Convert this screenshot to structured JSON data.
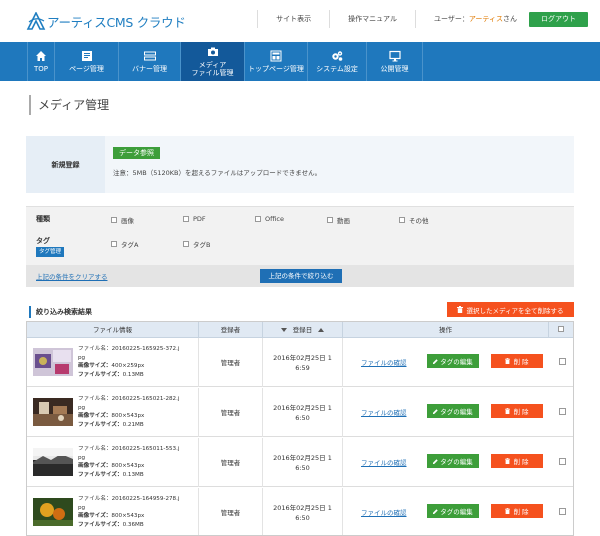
{
  "header": {
    "logo_text": "アーティスCMS クラウド",
    "site_view": "サイト表示",
    "manual": "操作マニュアル",
    "user_prefix": "ユーザー：",
    "user_name": "アーティス",
    "user_suffix": "さん",
    "logout": "ログアウト"
  },
  "nav": {
    "items": [
      {
        "label1": "TOP",
        "label2": "",
        "icon": "home-icon"
      },
      {
        "label1": "ページ管理",
        "label2": "",
        "icon": "document-icon"
      },
      {
        "label1": "バナー管理",
        "label2": "",
        "icon": "banner-icon"
      },
      {
        "label1": "メディア",
        "label2": "ファイル管理",
        "icon": "camera-icon",
        "active": true
      },
      {
        "label1": "トップページ管理",
        "label2": "",
        "icon": "layout-icon"
      },
      {
        "label1": "システム設定",
        "label2": "",
        "icon": "gear-icon"
      },
      {
        "label1": "公開管理",
        "label2": "",
        "icon": "monitor-icon"
      }
    ]
  },
  "page_title": "メディア管理",
  "register": {
    "label": "新規登録",
    "button": "データ参照",
    "note": "注意：5MB（5120KB）を超えるファイルはアップロードできません。"
  },
  "filter": {
    "type_label": "種類",
    "types": [
      "画像",
      "PDF",
      "Office",
      "動画",
      "その他"
    ],
    "tag_label": "タグ",
    "tag_manage": "タグ管理",
    "tags": [
      "タグA",
      "タグB"
    ],
    "clear": "上記の条件をクリアする",
    "submit": "上記の条件で絞り込む"
  },
  "results": {
    "title": "絞り込み検索結果",
    "delete_all": "選択したメディアを全て削除する",
    "columns": {
      "file_info": "ファイル情報",
      "registrant": "登録者",
      "date": "登録日",
      "action": "操作"
    },
    "labels": {
      "file_name": "ファイル名：",
      "image_size": "画像サイズ：",
      "file_size": "ファイルサイズ：",
      "view_file": "ファイルの確認",
      "edit_tags": "タグの編集",
      "delete": "削 除"
    },
    "rows": [
      {
        "name1": "20160225-165925-372.j",
        "name2": "pg",
        "img_size": "400×259px",
        "file_size": "0.13MB",
        "registrant": "管理者",
        "date1": "2016年02月25日 1",
        "date2": "6:59"
      },
      {
        "name1": "20160225-165021-282.j",
        "name2": "pg",
        "img_size": "800×543px",
        "file_size": "0.21MB",
        "registrant": "管理者",
        "date1": "2016年02月25日 1",
        "date2": "6:50"
      },
      {
        "name1": "20160225-165011-553.j",
        "name2": "pg",
        "img_size": "800×543px",
        "file_size": "0.13MB",
        "registrant": "管理者",
        "date1": "2016年02月25日 1",
        "date2": "6:50"
      },
      {
        "name1": "20160225-164959-278.j",
        "name2": "pg",
        "img_size": "800×543px",
        "file_size": "0.36MB",
        "registrant": "管理者",
        "date1": "2016年02月25日 1",
        "date2": "6:50"
      }
    ]
  },
  "colors": {
    "brand_blue": "#1f78bd",
    "nav_active": "#13599a",
    "green": "#3d9e3a",
    "orange": "#f5511e"
  }
}
